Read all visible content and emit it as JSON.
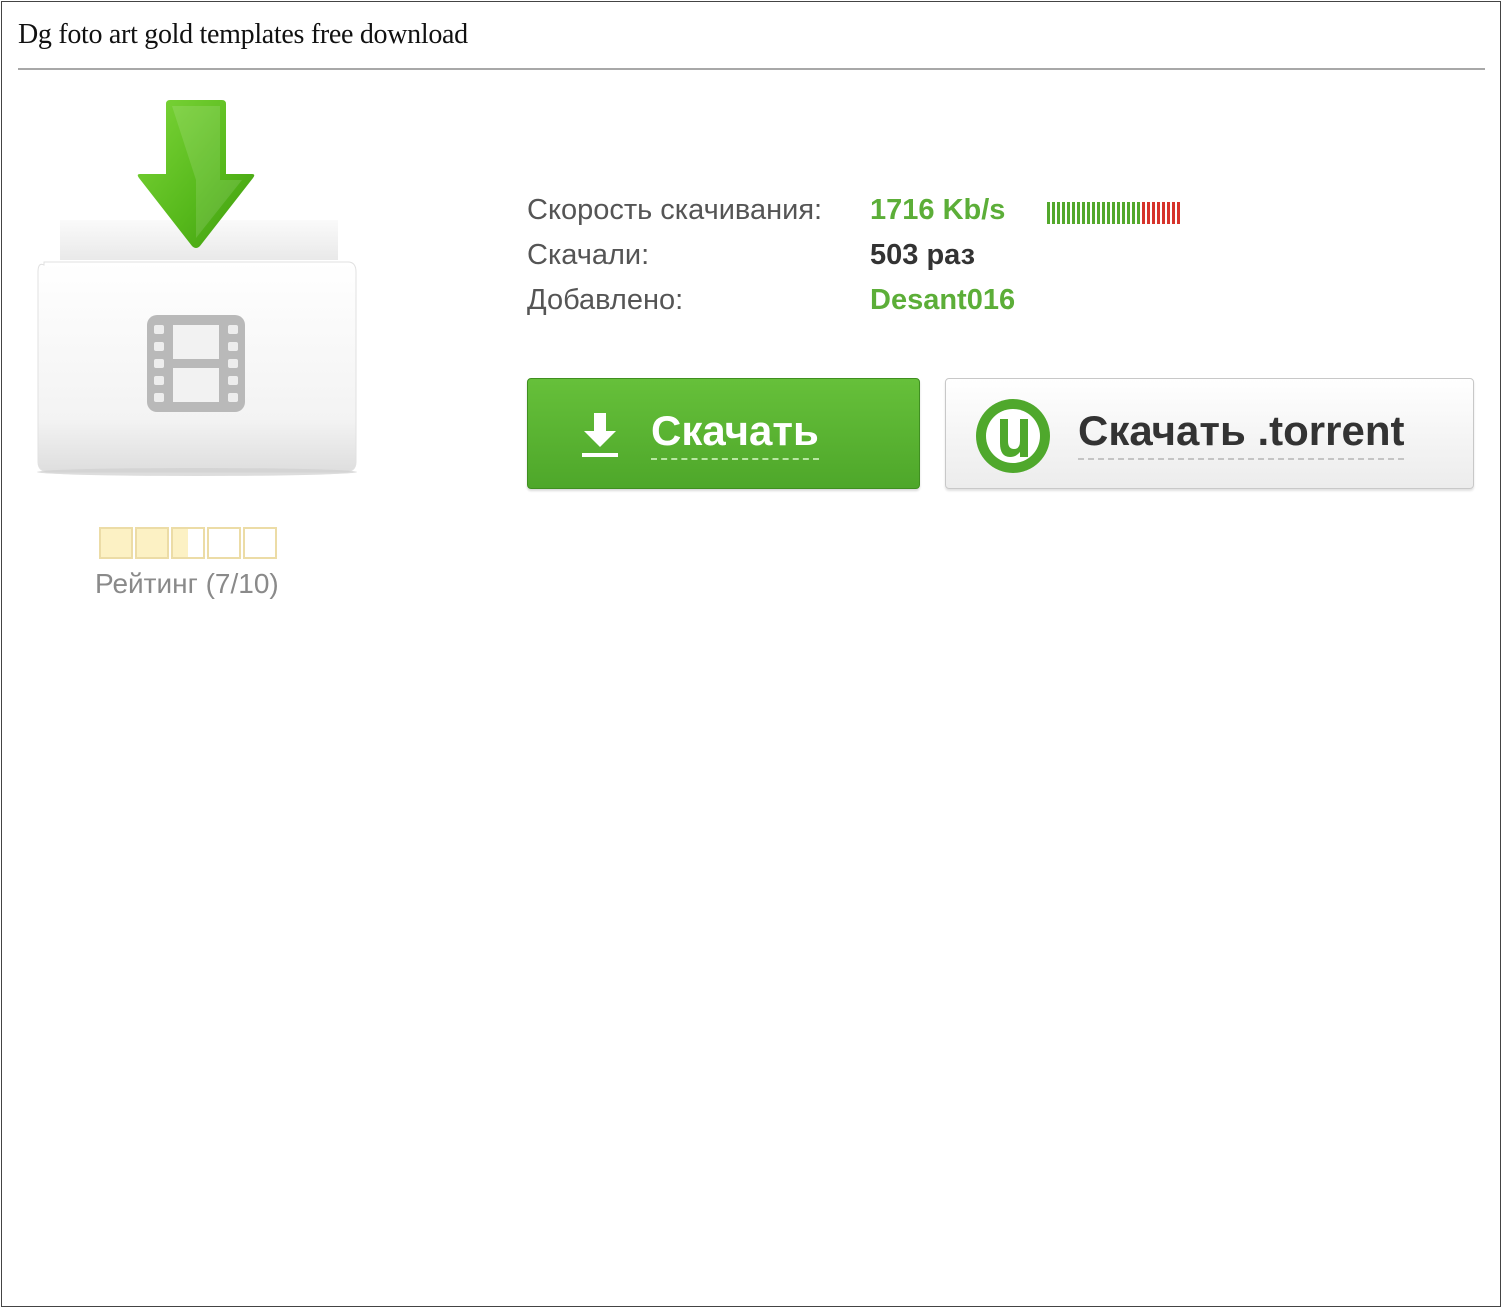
{
  "page": {
    "title": "Dg foto art gold templates free download"
  },
  "file_icon": {
    "icon": "download-video-folder-icon",
    "arrow_color": "#5cbf1e"
  },
  "rating": {
    "label": "Рейтинг (7/10)",
    "value": 7,
    "max": 10,
    "boxes": 5
  },
  "info": {
    "speed_label": "Скорость скачивания:",
    "speed_value": "1716 Kb/s",
    "speed_level": 0.72,
    "downloads_label": "Скачали:",
    "downloads_value": "503 раз",
    "added_label": "Добавлено:",
    "added_value": "Desant016"
  },
  "buttons": {
    "download_label": "Скачать",
    "torrent_label": "Скачать .torrent"
  },
  "colors": {
    "green": "#5cae38",
    "button_green": "#5cb431",
    "speed_green": "#53a82c",
    "speed_red": "#d6332b"
  }
}
